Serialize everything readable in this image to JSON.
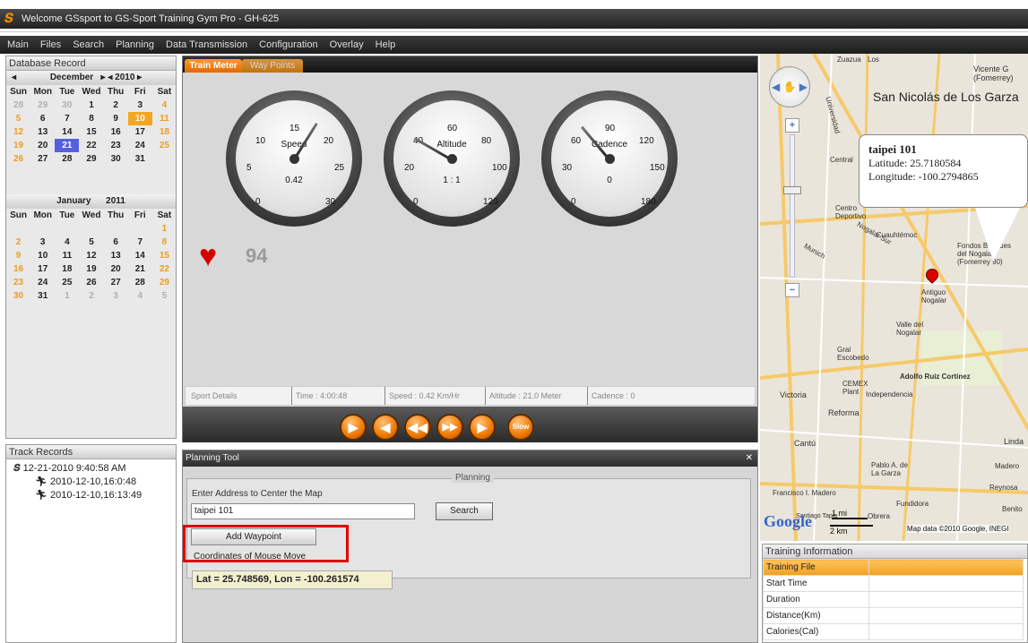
{
  "window": {
    "title": "Welcome GSsport to GS-Sport Training Gym Pro - GH-625"
  },
  "menu": [
    "Main",
    "Files",
    "Search",
    "Planning",
    "Data Transmission",
    "Configuration",
    "Overlay",
    "Help"
  ],
  "database_record": {
    "title": "Database Record",
    "cal1": {
      "month": "December",
      "year": "2010",
      "days_header": [
        "Sun",
        "Mon",
        "Tue",
        "Wed",
        "Thu",
        "Fri",
        "Sat"
      ],
      "rows": [
        [
          "28",
          "29",
          "30",
          "1",
          "2",
          "3",
          "4"
        ],
        [
          "5",
          "6",
          "7",
          "8",
          "9",
          "10",
          "11"
        ],
        [
          "12",
          "13",
          "14",
          "15",
          "16",
          "17",
          "18"
        ],
        [
          "19",
          "20",
          "21",
          "22",
          "23",
          "24",
          "25"
        ],
        [
          "26",
          "27",
          "28",
          "29",
          "30",
          "31",
          ""
        ]
      ]
    },
    "cal2": {
      "month": "January",
      "year": "2011",
      "days_header": [
        "Sun",
        "Mon",
        "Tue",
        "Wed",
        "Thu",
        "Fri",
        "Sat"
      ],
      "rows": [
        [
          "",
          "",
          "",
          "",
          "",
          "",
          "1"
        ],
        [
          "2",
          "3",
          "4",
          "5",
          "6",
          "7",
          "8"
        ],
        [
          "9",
          "10",
          "11",
          "12",
          "13",
          "14",
          "15"
        ],
        [
          "16",
          "17",
          "18",
          "19",
          "20",
          "21",
          "22"
        ],
        [
          "23",
          "24",
          "25",
          "26",
          "27",
          "28",
          "29"
        ],
        [
          "30",
          "31",
          "1",
          "2",
          "3",
          "4",
          "5"
        ]
      ]
    }
  },
  "track_records": {
    "title": "Track Records",
    "root": "12-21-2010 9:40:58 AM",
    "items": [
      "2010-12-10,16:0:48",
      "2010-12-10,16:13:49"
    ]
  },
  "train": {
    "tabs": [
      "Train Meter",
      "Way Points"
    ],
    "gauges": [
      {
        "label": "Speed",
        "value": "0.42",
        "ticks": [
          "0",
          "5",
          "10",
          "15",
          "20",
          "25",
          "30"
        ]
      },
      {
        "label": "Altitude",
        "value": "1 : 1",
        "ticks": [
          "0",
          "20",
          "40",
          "60",
          "80",
          "100",
          "120"
        ]
      },
      {
        "label": "Cadence",
        "value": "0",
        "ticks": [
          "0",
          "30",
          "60",
          "90",
          "120",
          "150",
          "180"
        ]
      }
    ],
    "heart_rate": "94",
    "details": {
      "label": "Sport Details",
      "time": "Time : 4:00:48",
      "speed": "Speed : 0.42 Km/Hr",
      "altitude": "Altitude : 21.0 Meter",
      "cadence": "Cadence : 0"
    },
    "slow": "Slow"
  },
  "planning": {
    "title": "Planning Tool",
    "group": "Planning",
    "prompt": "Enter Address to Center the Map",
    "address": "taipei 101",
    "search": "Search",
    "add_waypoint": "Add Waypoint",
    "coords_label": "Coordinates of Mouse Move",
    "coords": "Lat = 25.748569, Lon = -100.261574"
  },
  "map": {
    "popup_title": "taipei 101",
    "popup_lat": "Latitude: 25.7180584",
    "popup_lon": "Longitude: -100.2794865",
    "city": "San Nicolás de Los Garza",
    "scale_mi": "1 mi",
    "scale_km": "2 km",
    "attribution": "Map data ©2010 Google, INEGI",
    "labels": [
      "Vicente G (Fomerrey)",
      "Centro Deportivo",
      "Cuauhtémoc",
      "Fondos Bosques del Nogalar (Fomerrey 90)",
      "Antiguo Nogalar",
      "Valle del Nogalar",
      "Gral Escobedo",
      "Adolfo Ruiz Cortinez",
      "CEMEX Plant",
      "Independencia",
      "Victoria",
      "Reforma",
      "Cantú",
      "Pablo A. de La Garza",
      "Francisco I. Madero",
      "Fundidora",
      "Reynosa",
      "Linda",
      "Santiago Tapia",
      "Obrera",
      "Benito",
      "Madero",
      "Central",
      "Universidad",
      "Munich",
      "Nogalar Sur",
      "Zuazua",
      "Los"
    ]
  },
  "training_info": {
    "title": "Training Information",
    "rows": [
      "Training File",
      "Start Time",
      "Duration",
      "Distance(Km)",
      "Calories(Cal)"
    ]
  }
}
